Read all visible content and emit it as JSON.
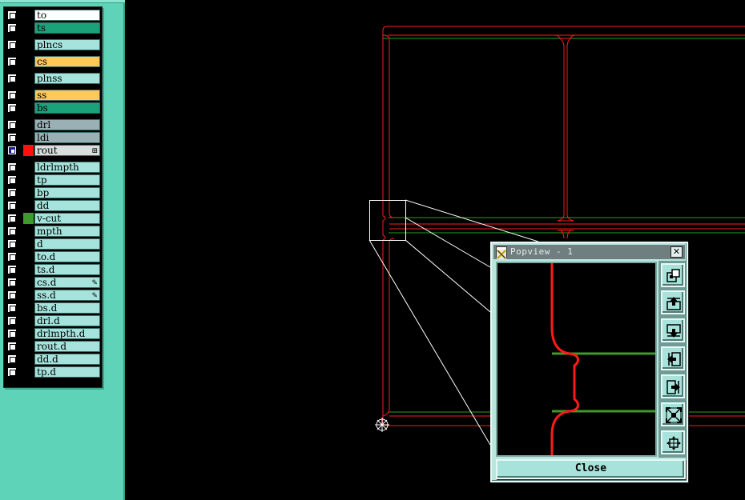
{
  "layers": [
    {
      "label": "to",
      "color": "#ffffff",
      "visible": true
    },
    {
      "label": "ts",
      "color": "#1aa37a",
      "visible": true
    },
    {
      "label": "plncs",
      "color": "#a6e3dc",
      "visible": true
    },
    {
      "label": "cs",
      "color": "#ffc95a",
      "visible": true
    },
    {
      "label": "plnss",
      "color": "#a6e3dc",
      "visible": true
    },
    {
      "label": "ss",
      "color": "#ffc95a",
      "visible": true
    },
    {
      "label": "bs",
      "color": "#1aa37a",
      "visible": true
    },
    {
      "label": "drl",
      "color": "#9bb0b4",
      "visible": true
    },
    {
      "label": "ldi",
      "color": "#9bb0b4",
      "visible": true
    },
    {
      "label": "rout",
      "color": "#dcdcdc",
      "visible": true,
      "active": true,
      "swatch": "#ff1010",
      "mark": "⊞"
    },
    {
      "label": "ldrlmpth",
      "color": "#a6e3dc",
      "visible": true
    },
    {
      "label": "tp",
      "color": "#a6e3dc",
      "visible": true
    },
    {
      "label": "bp",
      "color": "#a6e3dc",
      "visible": true
    },
    {
      "label": "dd",
      "color": "#a6e3dc",
      "visible": true
    },
    {
      "label": "v-cut",
      "color": "#a6e3dc",
      "visible": true,
      "swatch": "#3e9a2a"
    },
    {
      "label": "mpth",
      "color": "#a6e3dc",
      "visible": true
    },
    {
      "label": "d",
      "color": "#a6e3dc",
      "visible": true
    },
    {
      "label": "to.d",
      "color": "#a6e3dc",
      "visible": true
    },
    {
      "label": "ts.d",
      "color": "#a6e3dc",
      "visible": true
    },
    {
      "label": "cs.d",
      "color": "#a6e3dc",
      "visible": true,
      "mark": "✎"
    },
    {
      "label": "ss.d",
      "color": "#a6e3dc",
      "visible": true,
      "mark": "✎"
    },
    {
      "label": "bs.d",
      "color": "#a6e3dc",
      "visible": true
    },
    {
      "label": "drl.d",
      "color": "#a6e3dc",
      "visible": true
    },
    {
      "label": "drlmpth.d",
      "color": "#a6e3dc",
      "visible": true
    },
    {
      "label": "rout.d",
      "color": "#a6e3dc",
      "visible": true
    },
    {
      "label": "dd.d",
      "color": "#a6e3dc",
      "visible": true
    },
    {
      "label": "tp.d",
      "color": "#a6e3dc",
      "visible": true
    }
  ],
  "canvas": {
    "outline_color": "#ff1a1a",
    "guide_color": "#1fa01f",
    "zoom_box_color": "#ffffff",
    "origin_icon": "origin-crosshair-icon"
  },
  "popview": {
    "title": "Popview - 1",
    "close_label": "Close",
    "close_glyph": "✕",
    "tools": [
      "zoom-fit-icon",
      "pan-up-icon",
      "pan-down-icon",
      "pan-left-icon",
      "pan-right-icon",
      "zoom-in-icon",
      "zoom-out-icon"
    ]
  }
}
